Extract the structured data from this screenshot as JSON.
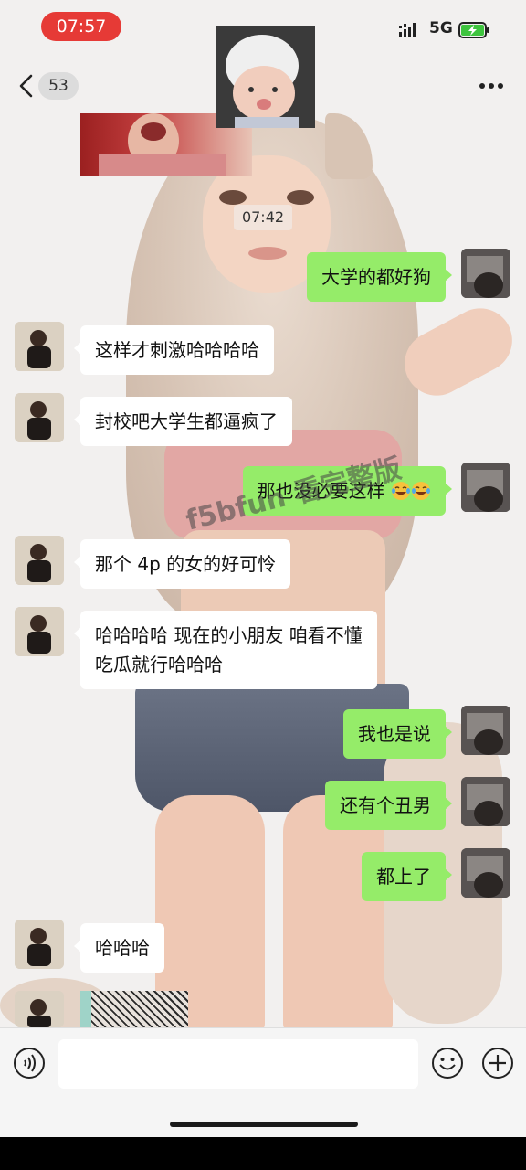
{
  "status_bar": {
    "time": "07:57",
    "network": "5G",
    "icons": [
      "signal-icon",
      "battery-charging-icon"
    ]
  },
  "nav": {
    "unread_count": "53",
    "icons": [
      "back-icon",
      "more-icon"
    ]
  },
  "chat": {
    "timestamp": "07:42",
    "watermark": "f5bfun 看完整版",
    "messages": [
      {
        "side": "self",
        "text": "大学的都好狗"
      },
      {
        "side": "other",
        "text": "这样才刺激哈哈哈哈"
      },
      {
        "side": "other",
        "text": "封校吧大学生都逼疯了"
      },
      {
        "side": "self",
        "text": "那也没必要这样",
        "emoji": [
          "laughing-crying-emoji",
          "laughing-crying-emoji"
        ]
      },
      {
        "side": "other",
        "text": "那个 4p 的女的好可怜"
      },
      {
        "side": "other",
        "lines": [
          "哈哈哈哈 现在的小朋友 咱看不懂",
          "吃瓜就行哈哈哈"
        ]
      },
      {
        "side": "self",
        "text": "我也是说"
      },
      {
        "side": "self",
        "text": "还有个丑男"
      },
      {
        "side": "self",
        "text": "都上了"
      },
      {
        "side": "other",
        "text": "哈哈哈"
      }
    ]
  },
  "input_bar": {
    "placeholder": "",
    "icons": [
      "voice-icon",
      "emoji-icon",
      "plus-icon"
    ]
  },
  "colors": {
    "self_bubble": "#95ec69",
    "other_bubble": "#ffffff",
    "status_time_pill": "#e63a36"
  }
}
